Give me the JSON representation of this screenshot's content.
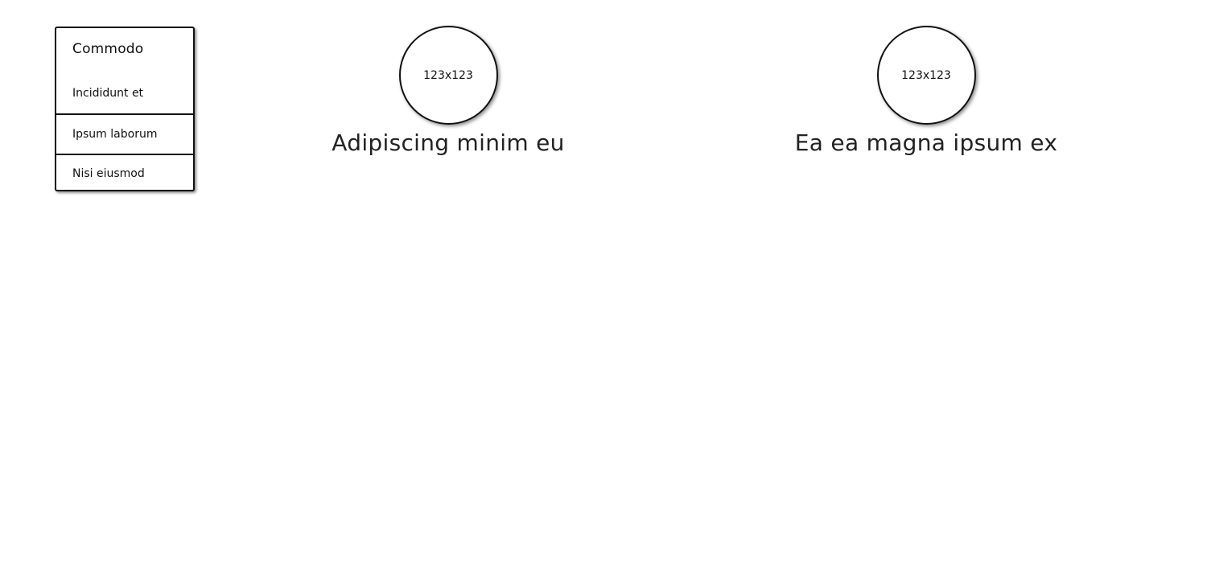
{
  "menu": {
    "title": "Commodo",
    "items": [
      {
        "label": "Incididunt et"
      },
      {
        "label": "Ipsum laborum"
      },
      {
        "label": "Nisi eiusmod"
      }
    ]
  },
  "profiles": [
    {
      "avatar_label": "123x123",
      "name": "Adipiscing minim eu"
    },
    {
      "avatar_label": "123x123",
      "name": "Ea ea magna ipsum ex"
    }
  ]
}
